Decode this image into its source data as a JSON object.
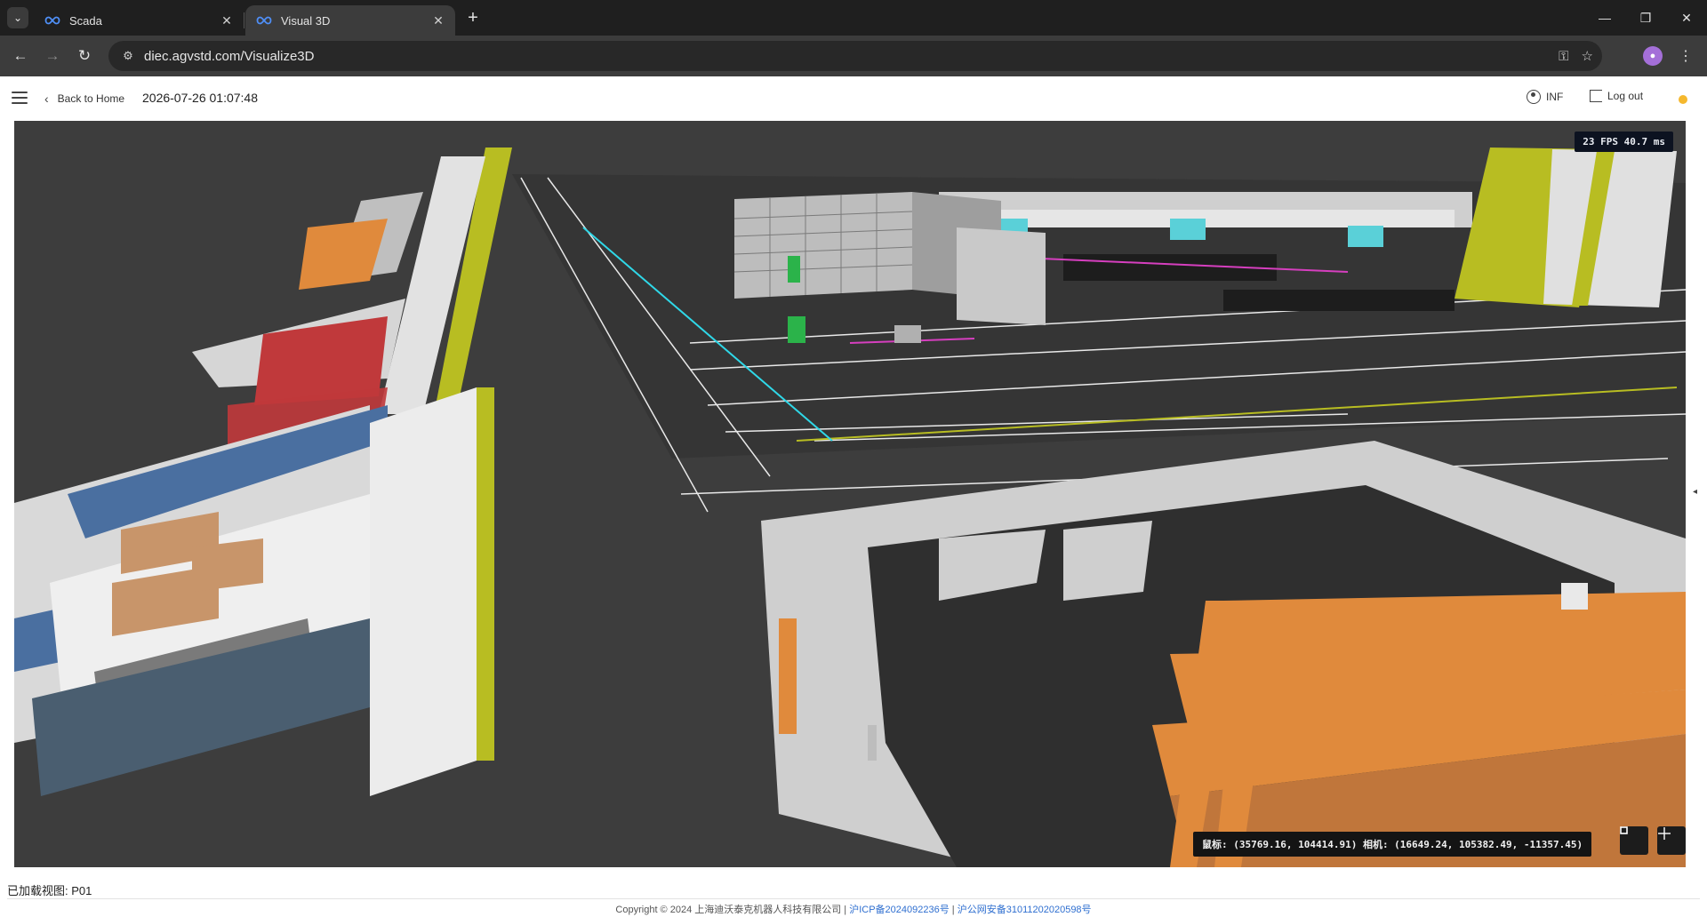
{
  "browser": {
    "tabs": [
      {
        "title": "Scada",
        "active": false
      },
      {
        "title": "Visual 3D",
        "active": true
      }
    ],
    "url": "diec.agvstd.com/Visualize3D",
    "icons": {
      "tab_search": "chevron-down-icon",
      "favicon": "infinity-icon",
      "close": "close-icon",
      "new_tab": "plus-icon",
      "back": "arrow-left-icon",
      "forward": "arrow-right-icon",
      "reload": "reload-icon",
      "site_info": "site-settings-icon",
      "password": "key-icon",
      "bookmark": "star-icon",
      "menu": "kebab-icon"
    }
  },
  "header": {
    "back_label": "Back to Home",
    "datetime": "2026-07-26 01:07:48",
    "user_label": "INF",
    "logout_label": "Log out",
    "status_color": "#f5b82e"
  },
  "viewport": {
    "fps_label": "23 FPS 40.7 ms",
    "coords_label": "鼠标: (35769.16, 104414.91)  相机: (16649.24, 105382.49, -11357.45)",
    "scene_colors": {
      "floor": "#3d3d3d",
      "wall": "#d4d4d4",
      "accent_yellow": "#b8bd22",
      "accent_orange": "#e08a3c",
      "accent_red": "#c0393b",
      "accent_blue": "#4a6fa0",
      "accent_cyan": "#2fd8e8"
    }
  },
  "footer": {
    "loaded_view": "已加载视图: P01",
    "copyright_text": "Copyright © 2024 上海迪沃泰克机器人科技有限公司 | ",
    "icp_link": "沪ICP备2024092236号",
    "separator": " | ",
    "police_link": "沪公网安备31011202020598号"
  }
}
